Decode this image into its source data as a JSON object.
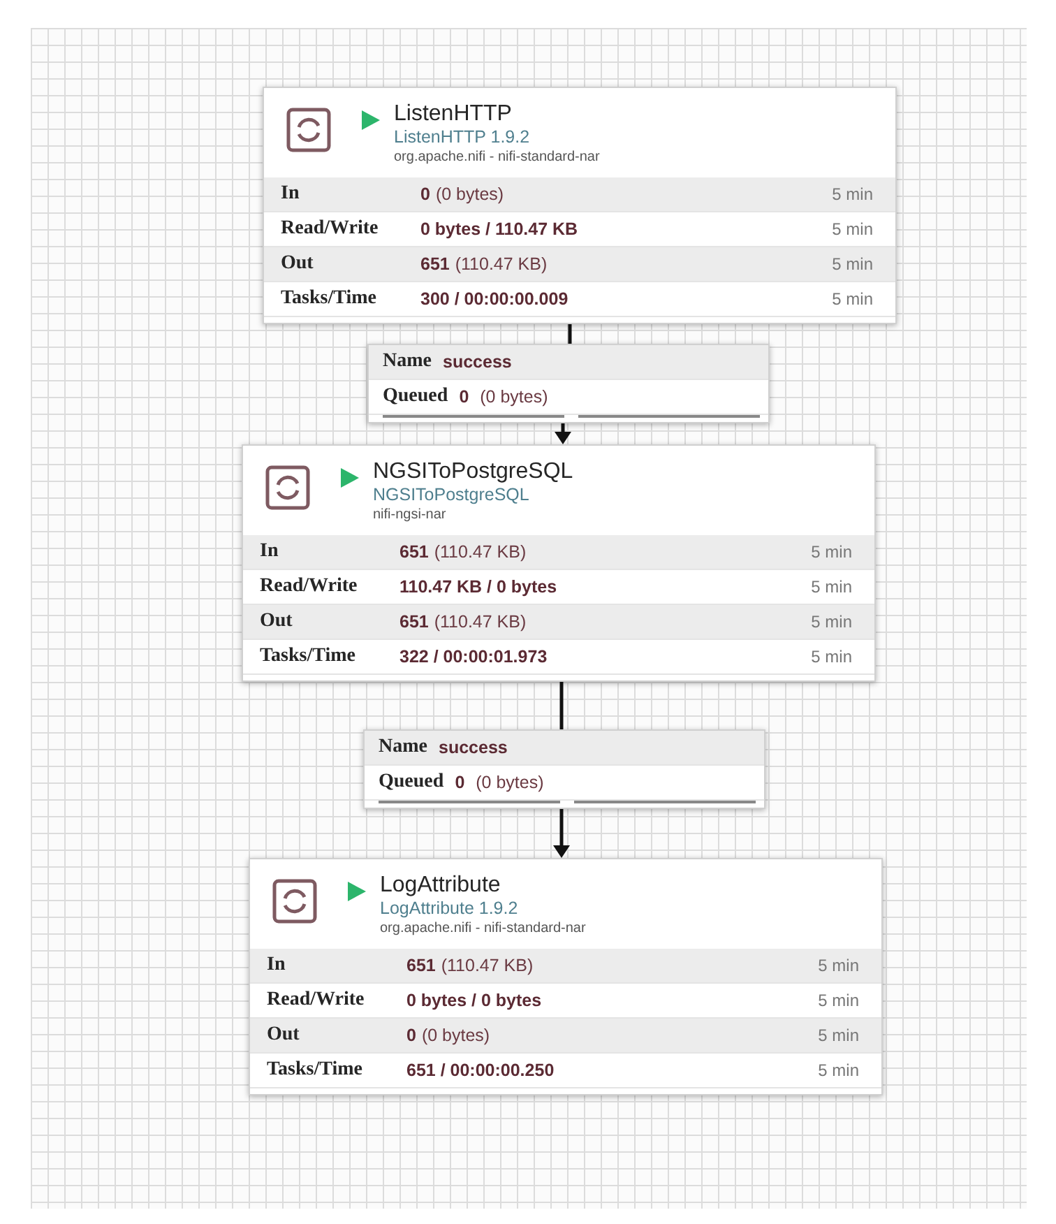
{
  "processors": [
    {
      "name": "ListenHTTP",
      "type": "ListenHTTP 1.9.2",
      "bundle": "org.apache.nifi - nifi-standard-nar",
      "running": true,
      "stats": [
        {
          "label": "In",
          "value": "0",
          "detail": "(0 bytes)",
          "window": "5 min"
        },
        {
          "label": "Read/Write",
          "value": "0 bytes / 110.47 KB",
          "window": "5 min"
        },
        {
          "label": "Out",
          "value": "651",
          "detail": "(110.47 KB)",
          "window": "5 min"
        },
        {
          "label": "Tasks/Time",
          "value": "300 / 00:00:00.009",
          "window": "5 min"
        }
      ]
    },
    {
      "name": "NGSIToPostgreSQL",
      "type": "NGSIToPostgreSQL",
      "bundle": "nifi-ngsi-nar",
      "running": true,
      "stats": [
        {
          "label": "In",
          "value": "651",
          "detail": "(110.47 KB)",
          "window": "5 min"
        },
        {
          "label": "Read/Write",
          "value": "110.47 KB / 0 bytes",
          "window": "5 min"
        },
        {
          "label": "Out",
          "value": "651",
          "detail": "(110.47 KB)",
          "window": "5 min"
        },
        {
          "label": "Tasks/Time",
          "value": "322 / 00:00:01.973",
          "window": "5 min"
        }
      ]
    },
    {
      "name": "LogAttribute",
      "type": "LogAttribute 1.9.2",
      "bundle": "org.apache.nifi - nifi-standard-nar",
      "running": true,
      "stats": [
        {
          "label": "In",
          "value": "651",
          "detail": "(110.47 KB)",
          "window": "5 min"
        },
        {
          "label": "Read/Write",
          "value": "0 bytes / 0 bytes",
          "window": "5 min"
        },
        {
          "label": "Out",
          "value": "0",
          "detail": "(0 bytes)",
          "window": "5 min"
        },
        {
          "label": "Tasks/Time",
          "value": "651 / 00:00:00.250",
          "window": "5 min"
        }
      ]
    }
  ],
  "connections": [
    {
      "name_label": "Name",
      "name": "success",
      "queued_label": "Queued",
      "queued_count": "0",
      "queued_size": "(0 bytes)"
    },
    {
      "name_label": "Name",
      "name": "success",
      "queued_label": "Queued",
      "queued_count": "0",
      "queued_size": "(0 bytes)"
    }
  ]
}
